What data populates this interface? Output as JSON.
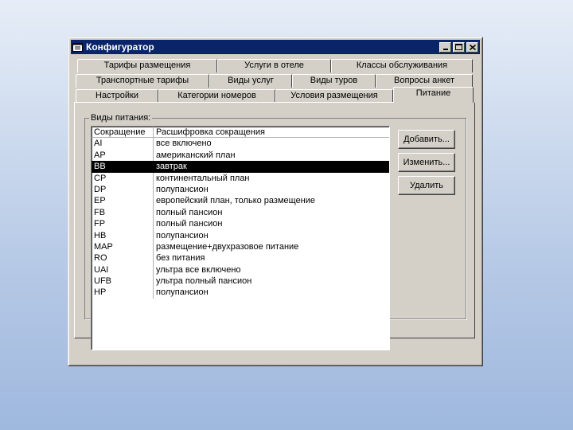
{
  "window": {
    "title": "Конфигуратор"
  },
  "tabs": {
    "row1": [
      "Тарифы размещения",
      "Услуги в отеле",
      "Классы обслуживания"
    ],
    "row2": [
      "Транспортные тарифы",
      "Виды услуг",
      "Виды туров",
      "Вопросы анкет"
    ],
    "row3": [
      "Настройки",
      "Категории номеров",
      "Условия размещения",
      "Питание"
    ]
  },
  "group": {
    "label": "Виды питания:"
  },
  "list": {
    "headers": [
      "Сокращение",
      "Расшифровка сокращения"
    ],
    "rows": [
      [
        "AI",
        "все включено"
      ],
      [
        "AP",
        "американский план"
      ],
      [
        "BB",
        "завтрак"
      ],
      [
        "CP",
        "континентальный план"
      ],
      [
        "DP",
        "полупансион"
      ],
      [
        "EP",
        "европейский план, только размещение"
      ],
      [
        "FB",
        "полный пансион"
      ],
      [
        "FP",
        "полный пансион"
      ],
      [
        "HB",
        "полупансион"
      ],
      [
        "MAP",
        "размещение+двухразовое питание"
      ],
      [
        "RO",
        "без питания"
      ],
      [
        "UAI",
        "ультра все включено"
      ],
      [
        "UFB",
        "ультра полный пансион"
      ],
      [
        "HP",
        "полупансион"
      ]
    ],
    "selected_row": "BB"
  },
  "buttons": {
    "add": "Добавить...",
    "edit": "Изменить...",
    "delete": "Удалить"
  },
  "colors": {
    "titlebar": "#0a246a",
    "face": "#d4d0c8",
    "selection": "#000000"
  }
}
